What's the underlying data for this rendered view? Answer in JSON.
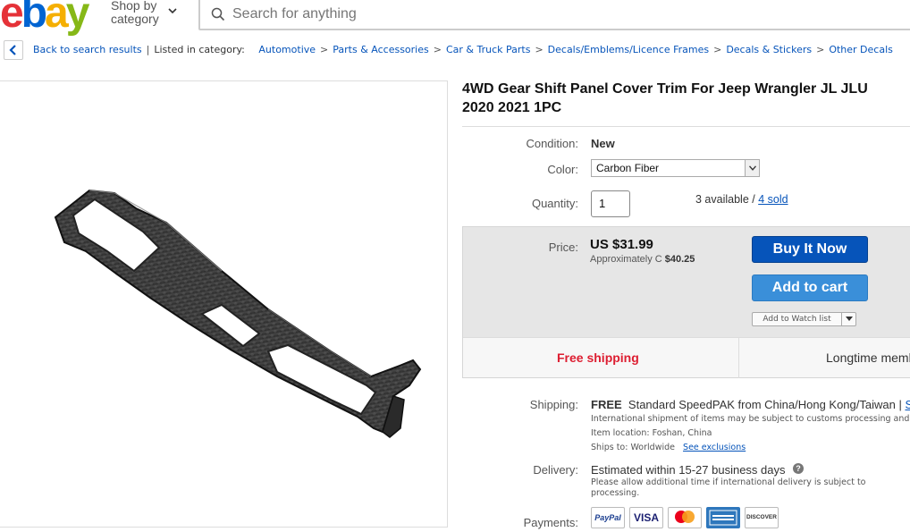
{
  "header": {
    "logo": [
      "e",
      "b",
      "a",
      "y"
    ],
    "logo_colors": [
      "#e53238",
      "#0064d2",
      "#f5af02",
      "#86b817"
    ],
    "shop_by_line1": "Shop by",
    "shop_by_line2": "category",
    "search_placeholder": "Search for anything"
  },
  "breadcrumb": {
    "back": "Back to search results",
    "listed_in": "Listed in category:",
    "categories": [
      "Automotive",
      "Parts & Accessories",
      "Car & Truck Parts",
      "Decals/Emblems/Licence Frames",
      "Decals & Stickers",
      "Other Decals"
    ]
  },
  "item": {
    "title_line1": "4WD Gear Shift Panel Cover Trim For Jeep Wrangler JL JLU",
    "title_line2": "2020 2021 1PC",
    "condition_label": "Condition:",
    "condition": "New",
    "color_label": "Color:",
    "color_selected": "Carbon Fiber",
    "quantity_label": "Quantity:",
    "quantity": "1",
    "available_text": "3 available / ",
    "sold_link": "4 sold"
  },
  "pricing": {
    "price_label": "Price:",
    "price": "US $31.99",
    "approx_label": "Approximately C ",
    "approx_value": "$40.25",
    "buy_now": "Buy It Now",
    "add_to_cart": "Add to cart",
    "watch_list": "Add to Watch list",
    "free_shipping": "Free shipping",
    "longtime": "Longtime memb"
  },
  "shipping": {
    "shipping_label": "Shipping:",
    "shipping_free": "FREE",
    "shipping_service": "Standard SpeedPAK from China/Hong Kong/Taiwan |",
    "shipping_more": "Se",
    "customs_note": "International shipment of items may be subject to customs processing and ad",
    "item_location_label": "Item location:",
    "item_location": "Foshan, China",
    "ships_to_label": "Ships to:",
    "ships_to": "Worldwide",
    "see_exclusions": "See exclusions",
    "delivery_label": "Delivery:",
    "delivery_estimate": "Estimated within 15-27 business days",
    "delivery_note_line1": "Please allow additional time if international delivery is subject to",
    "delivery_note_line2": "processing.",
    "help_glyph": "?",
    "payments_label": "Payments:",
    "payment_methods": [
      "PayPal",
      "VISA",
      "Mastercard",
      "AMERICAN EXPRESS",
      "DISCOVER"
    ]
  }
}
